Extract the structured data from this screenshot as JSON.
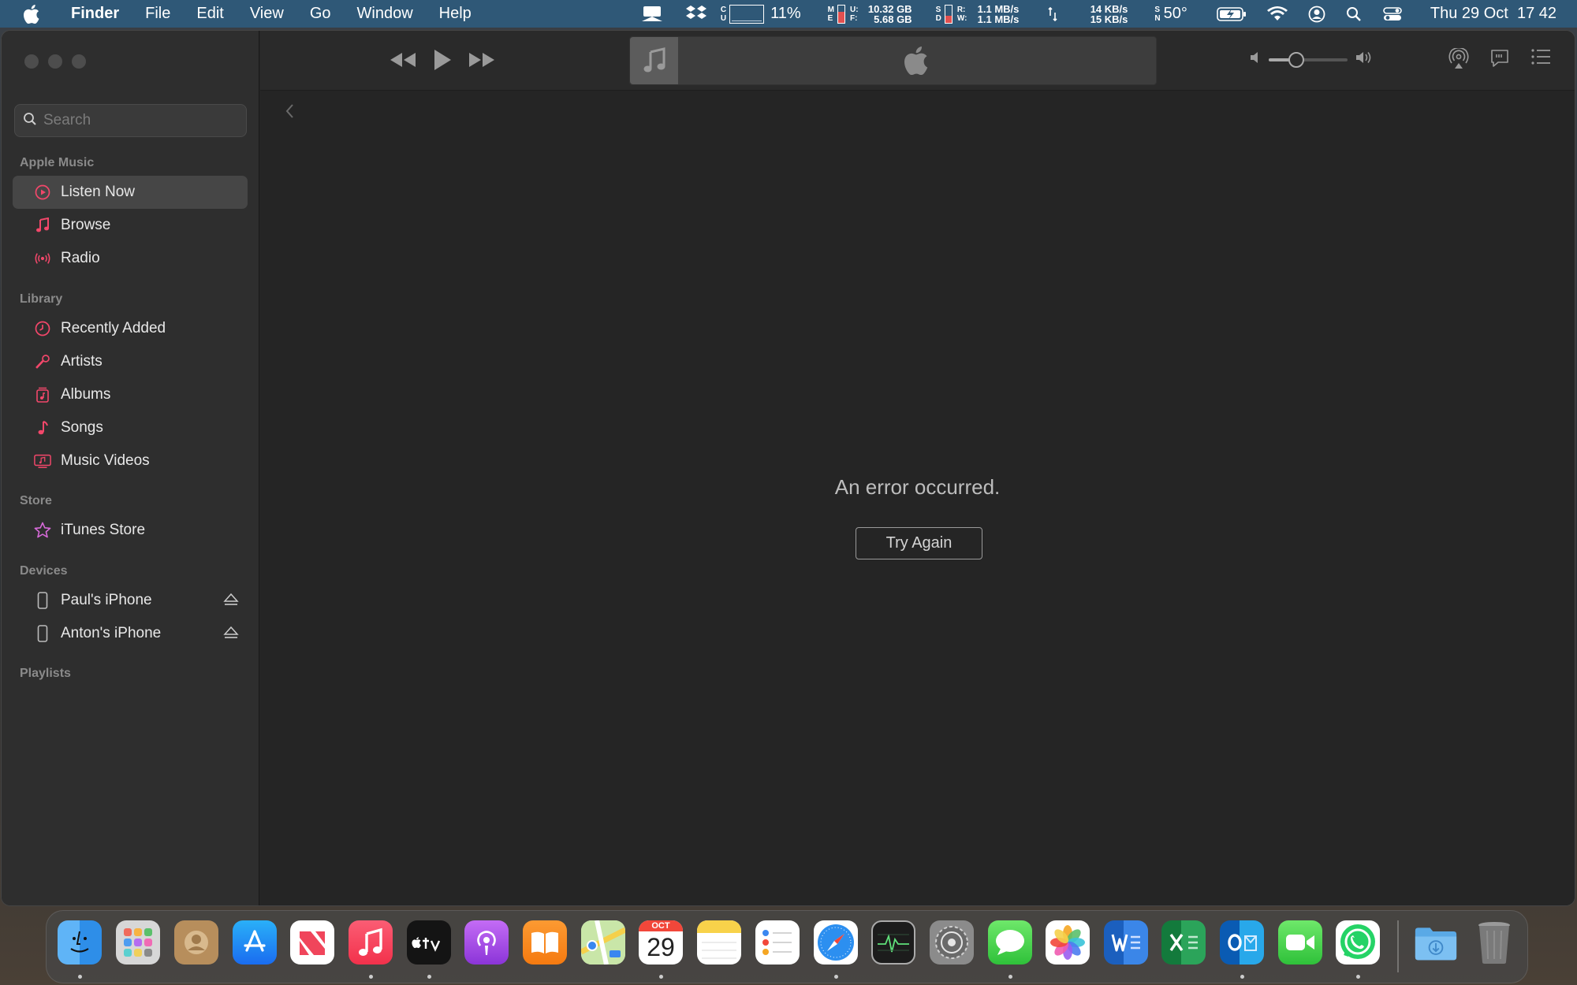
{
  "menubar": {
    "app_name": "Finder",
    "menus": [
      "File",
      "Edit",
      "View",
      "Go",
      "Window",
      "Help"
    ],
    "cpu_label_top": "C",
    "cpu_label_bottom": "U",
    "cpu_percent": "11%",
    "mem_label_top": "M",
    "mem_label_bottom": "E",
    "mem_used_label": "U:",
    "mem_free_label": "F:",
    "mem_used": "10.32 GB",
    "mem_free": "5.68 GB",
    "disk_label_top": "S",
    "disk_label_bottom": "D",
    "disk_read_label": "R:",
    "disk_write_label": "W:",
    "disk_read": "1.1 MB/s",
    "disk_write": "1.1 MB/s",
    "net_up": "14 KB/s",
    "net_down": "15 KB/s",
    "temp_label_top": "S",
    "temp_label_bottom": "N",
    "temperature": "50°",
    "datetime": "Thu 29 Oct  17 42"
  },
  "sidebar": {
    "search_placeholder": "Search",
    "sections": {
      "apple_music": "Apple Music",
      "library": "Library",
      "store": "Store",
      "devices": "Devices",
      "playlists": "Playlists"
    },
    "apple_music_items": [
      "Listen Now",
      "Browse",
      "Radio"
    ],
    "library_items": [
      "Recently Added",
      "Artists",
      "Albums",
      "Songs",
      "Music Videos"
    ],
    "store_items": [
      "iTunes Store"
    ],
    "device_items": [
      "Paul's iPhone",
      "Anton's iPhone"
    ],
    "active_item": "Listen Now"
  },
  "toolbar": {
    "volume_level": 0.35
  },
  "content": {
    "error_message": "An error occurred.",
    "retry_label": "Try Again"
  },
  "dock": {
    "calendar_month": "OCT",
    "calendar_day": "29"
  },
  "colors": {
    "accent_pink": "#f2476a",
    "menubar_bg": "#2f5877",
    "sidebar_bg": "#2e2e2e",
    "content_bg": "#252525"
  }
}
